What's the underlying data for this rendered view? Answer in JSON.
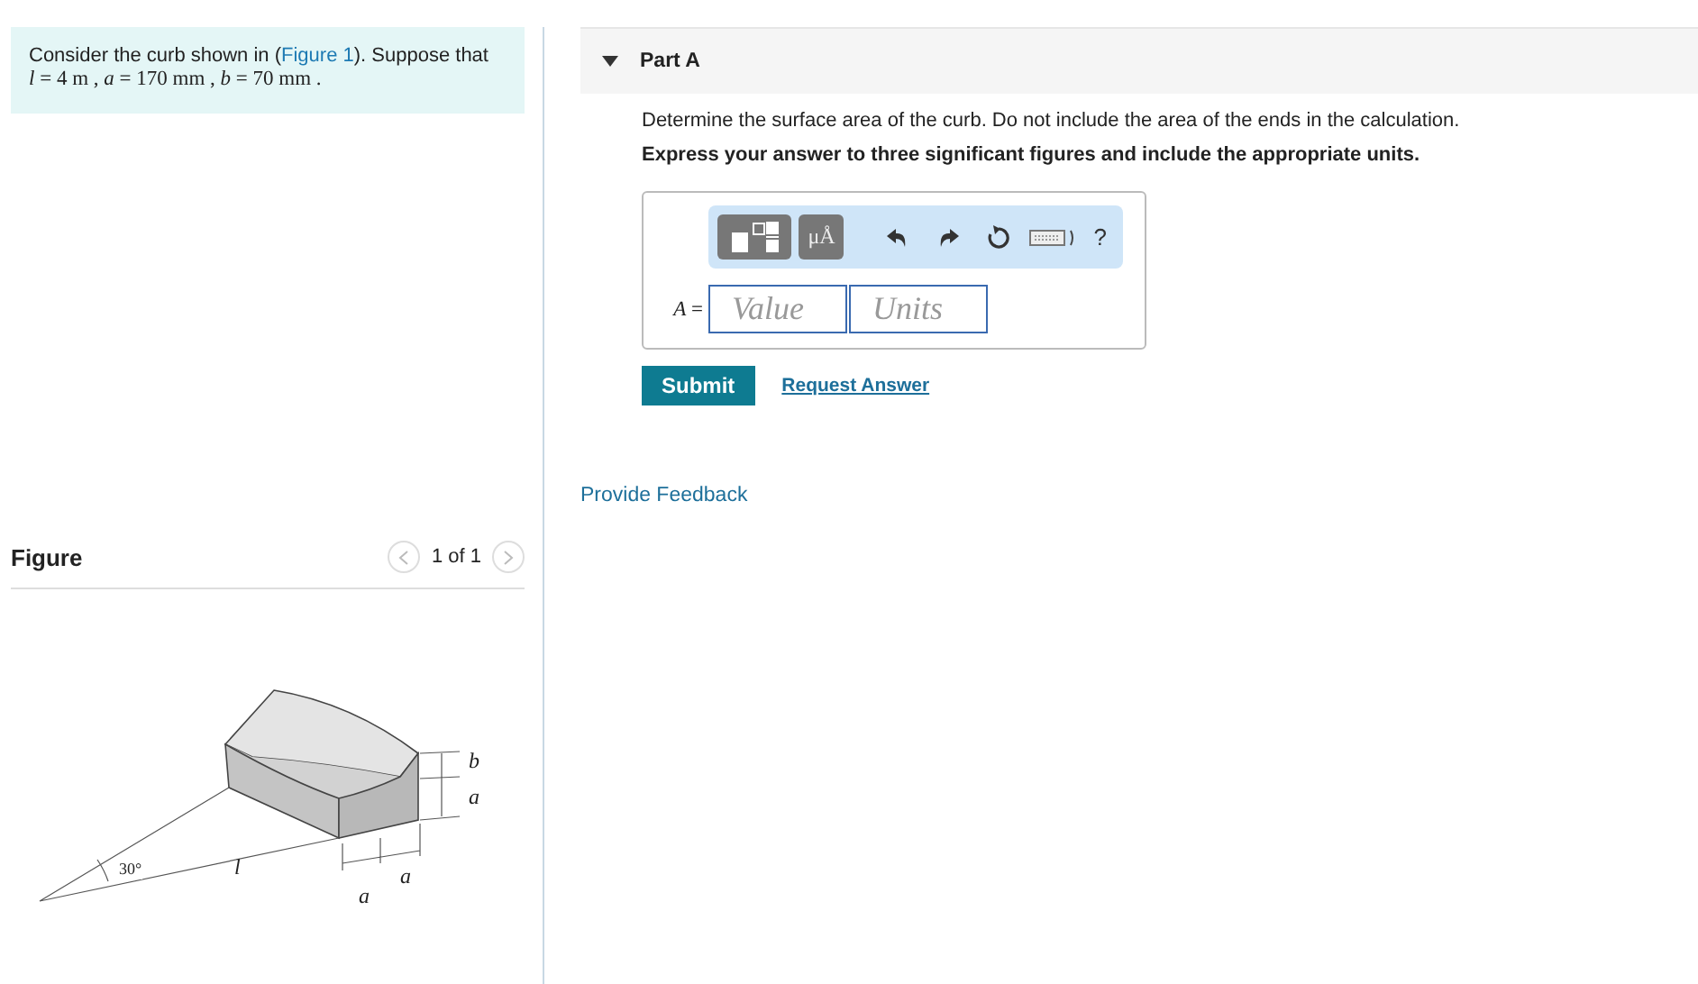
{
  "problem": {
    "intro_before": "Consider the curb shown in (",
    "link": "Figure 1",
    "intro_after": "). Suppose that",
    "given": "*l* = 4  m , *a* = 170  mm , *b* = 70  mm ."
  },
  "figure": {
    "title": "Figure",
    "pager": "1 of 1",
    "prev_disabled": true,
    "next_disabled": true,
    "labels": [
      {
        "text": "b",
        "kind": "b"
      },
      {
        "text": "a",
        "kind": "a-height"
      },
      {
        "text": "30°",
        "kind": "angle"
      },
      {
        "text": "l",
        "kind": "l"
      },
      {
        "text": "a",
        "kind": "a-right"
      },
      {
        "text": "a",
        "kind": "a-left"
      }
    ]
  },
  "part": {
    "title": "Part A",
    "expanded": true,
    "question": "Determine the surface area of the curb. Do not include the area of the ends in the calculation.",
    "instruction": "Express your answer to three significant figures and include the appropriate units.",
    "toolbar": {
      "units_symbol": "μÅ",
      "help": "?"
    },
    "answer": {
      "label": "*A* =",
      "value_placeholder": "Value",
      "units_placeholder": "Units"
    },
    "submit": "Submit",
    "request": "Request Answer"
  },
  "feedback": "Provide Feedback"
}
